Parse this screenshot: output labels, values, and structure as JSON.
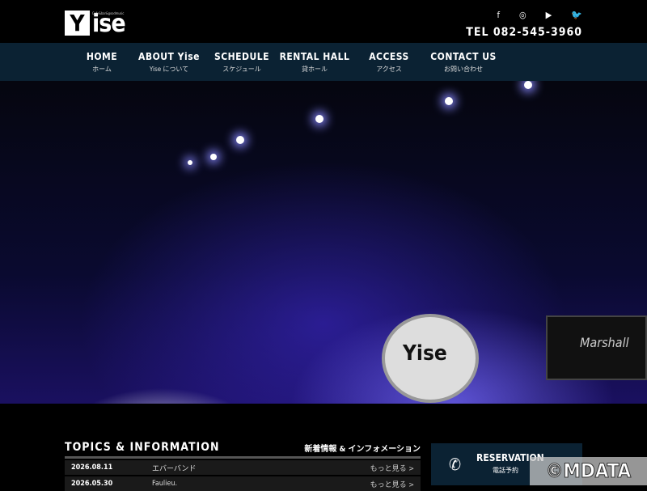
{
  "header": {
    "logo_main": "Y",
    "logo_rest": "ise",
    "logo_tagline": "Cafe&bar&goodmusic",
    "tel": "TEL 082-545-3960",
    "social": [
      {
        "icon": "facebook-icon",
        "glyph": "f"
      },
      {
        "icon": "instagram-icon",
        "glyph": "◎"
      },
      {
        "icon": "youtube-icon",
        "glyph": "▶"
      },
      {
        "icon": "twitter-icon",
        "glyph": "🐦"
      }
    ]
  },
  "nav": [
    {
      "en": "HOME",
      "ja": "ホーム"
    },
    {
      "en": "ABOUT Yise",
      "ja": "Yise について"
    },
    {
      "en": "SCHEDULE",
      "ja": "スケジュール"
    },
    {
      "en": "RENTAL HALL",
      "ja": "貸ホール"
    },
    {
      "en": "ACCESS",
      "ja": "アクセス"
    },
    {
      "en": "CONTACT US",
      "ja": "お問い合わせ"
    }
  ],
  "hero": {
    "drum_logo": "Yise",
    "amp_brand": "Marshall"
  },
  "topics": {
    "title": "TOPICS & INFORMATION",
    "subtitle": "新着情報 & インフォメーション",
    "items": [
      {
        "date": "2026.08.11",
        "title": "エバーバンド",
        "more": "もっと見る >"
      },
      {
        "date": "2026.05.30",
        "title": "Faulieu.",
        "more": "もっと見る >"
      }
    ]
  },
  "reservation": {
    "label": "RESERVATION",
    "sub": "電話予約"
  },
  "watermark": "©MDATA",
  "colors": {
    "nav_bg": "#0b2233"
  }
}
